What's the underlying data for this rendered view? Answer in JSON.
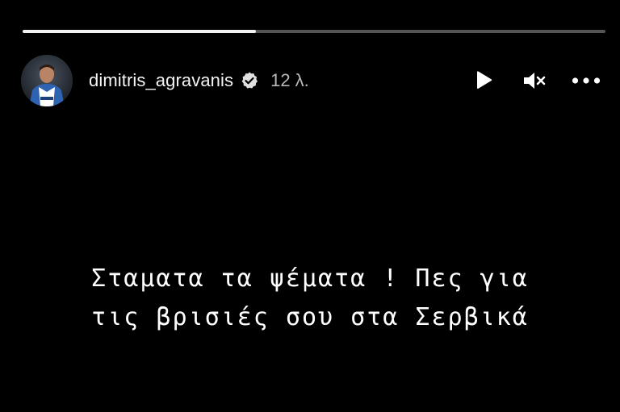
{
  "story": {
    "progress": 0.4,
    "user": {
      "username": "dimitris_agravanis",
      "verified": true,
      "time": "12 λ."
    },
    "controls": {
      "play_icon": "play-icon",
      "mute_icon": "speaker-muted-icon",
      "more_icon": "more-options-icon"
    },
    "caption": {
      "line1": "Σταματα τα ψέματα ! Πες για",
      "line2": "τις βρισιές σου στα Σερβικά"
    },
    "colors": {
      "background": "#000000",
      "progress_track": "#555555",
      "progress_fill": "#f2f2f2",
      "text": "#ffffff",
      "time_text": "#b8b8b8"
    }
  }
}
